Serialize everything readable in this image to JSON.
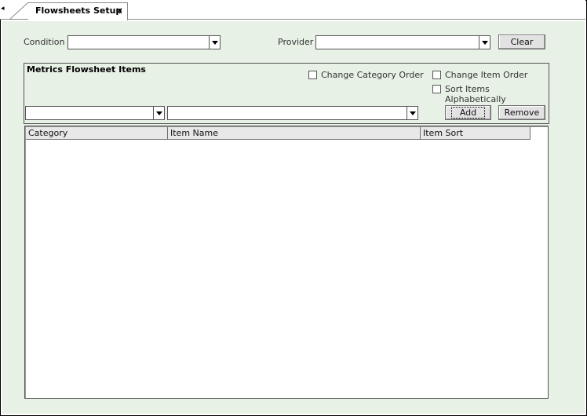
{
  "tab": {
    "label": "Flowsheets Setup",
    "close_glyph": "✕",
    "scroll_glyph": "◂"
  },
  "filters": {
    "condition_label": "Condition",
    "condition_value": "",
    "provider_label": "Provider",
    "provider_value": "",
    "clear_label": "Clear"
  },
  "metrics": {
    "title": "Metrics Flowsheet Items",
    "change_category_order": "Change Category Order",
    "change_item_order": "Change Item Order",
    "sort_alphabetically": "Sort Items Alphabetically",
    "category_value": "",
    "item_value": "",
    "add_label": "Add",
    "remove_label": "Remove"
  },
  "grid": {
    "columns": [
      "Category",
      "Item Name",
      "Item Sort"
    ],
    "rows": []
  },
  "colors": {
    "panel_bg": "#e7f1e5",
    "border": "#555555"
  }
}
